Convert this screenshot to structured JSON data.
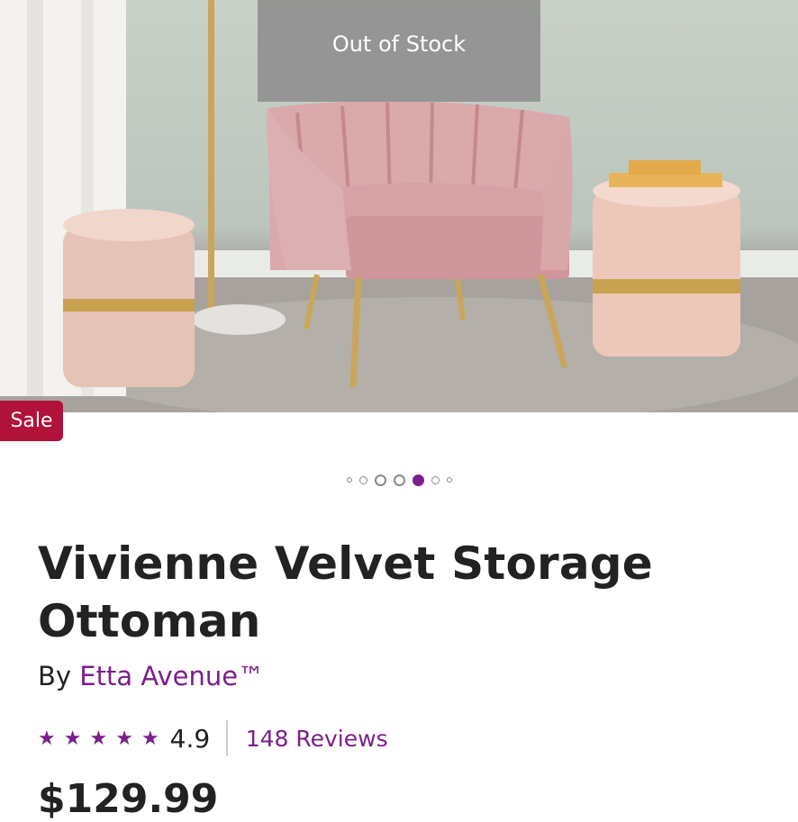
{
  "hero": {
    "out_of_stock_label": "Out of Stock",
    "sale_label": "Sale"
  },
  "carousel": {
    "slide_count": 7,
    "active_index": 4
  },
  "product": {
    "title": "Vivienne Velvet Storage Ottoman",
    "by_label": "By",
    "brand": "Etta Avenue™",
    "rating": "4.9",
    "rating_stars": 5,
    "reviews_label": "148 Reviews",
    "price": "$129.99"
  },
  "colors": {
    "accent": "#7b1f8c",
    "sale_badge": "#b1123a",
    "text": "#222222"
  }
}
